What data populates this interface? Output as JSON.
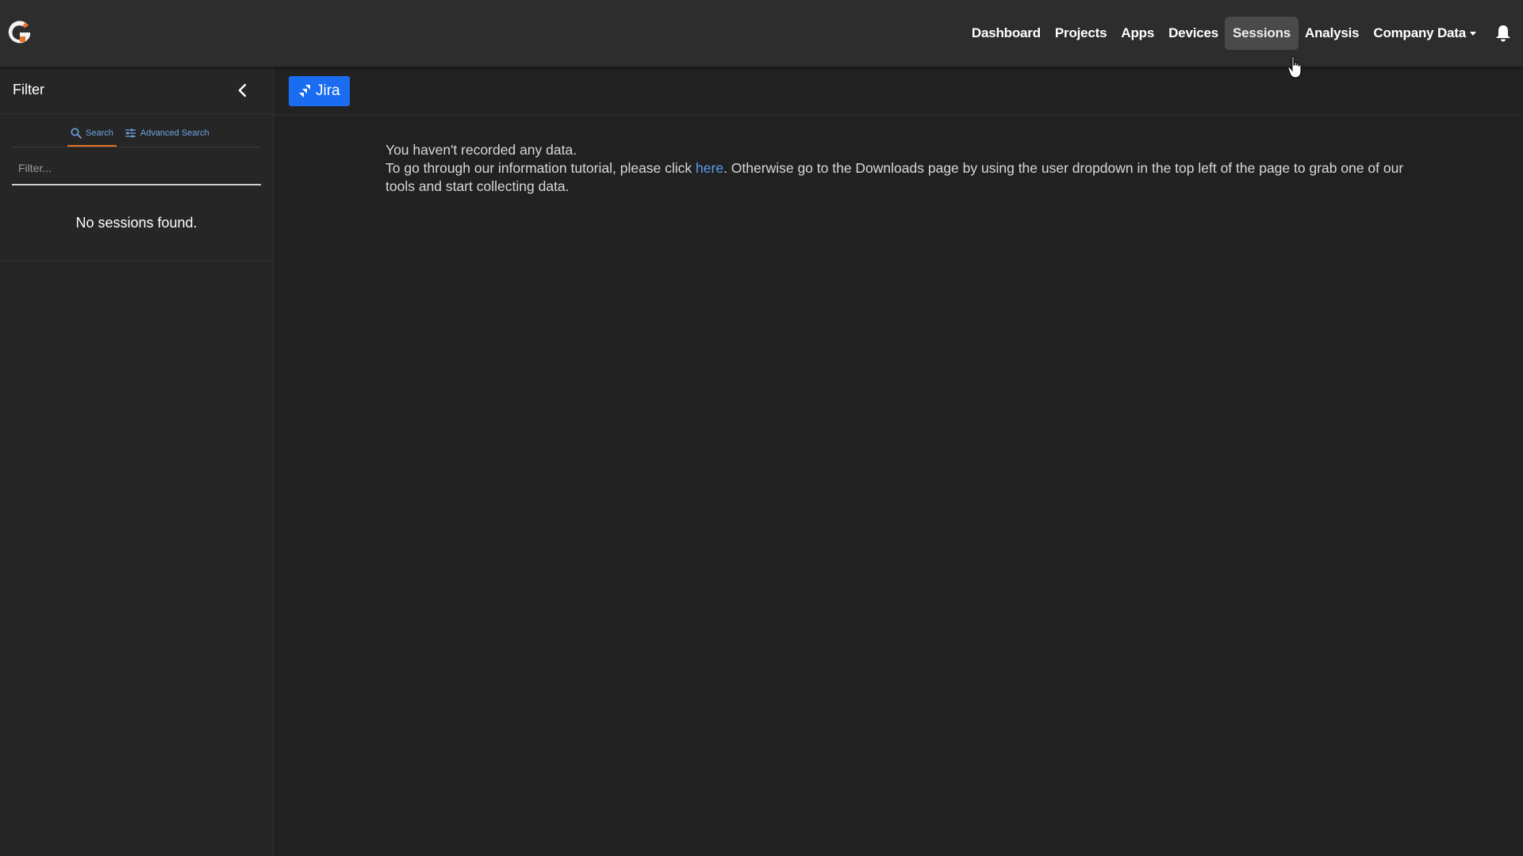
{
  "navbar": {
    "items": [
      {
        "label": "Dashboard"
      },
      {
        "label": "Projects"
      },
      {
        "label": "Apps"
      },
      {
        "label": "Devices"
      },
      {
        "label": "Sessions",
        "active": true
      },
      {
        "label": "Analysis"
      },
      {
        "label": "Company Data",
        "dropdown": true
      }
    ],
    "bell_icon": "bell-icon",
    "logo_icon": "g-logo-icon"
  },
  "sidebar": {
    "title": "Filter",
    "tabs": [
      {
        "label": "Search",
        "icon": "search-icon",
        "active": true
      },
      {
        "label": "Advanced Search",
        "icon": "sliders-icon"
      }
    ],
    "filter_placeholder": "Filter...",
    "filter_value": "",
    "empty_text": "No sessions found."
  },
  "toolbar": {
    "jira_label": "Jira"
  },
  "message": {
    "line1": "You haven't recorded any data.",
    "line2_prefix": "To go through our information tutorial, please click ",
    "link_text": "here",
    "line2_suffix": ". Otherwise go to the Downloads page by using the user dropdown in the top left of the page to grab one of our tools and start collecting data."
  },
  "colors": {
    "accent_orange": "#e8732a",
    "link_blue": "#5b9cf0",
    "jira_blue": "#1a6cf0",
    "background": "#222222",
    "navbar": "#2d2d2d"
  }
}
